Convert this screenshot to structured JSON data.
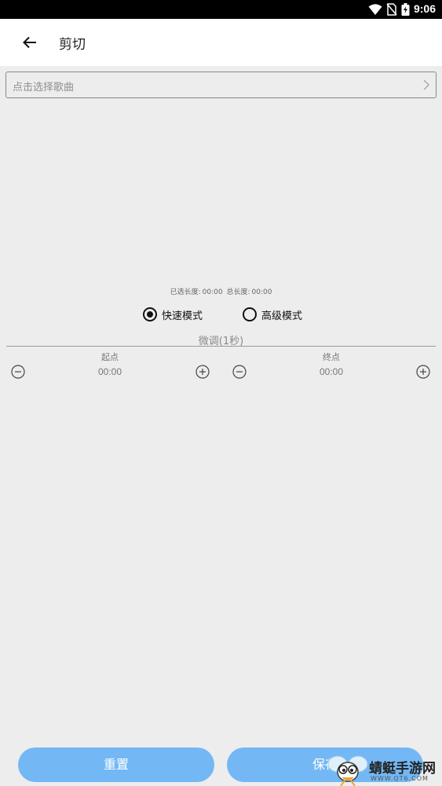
{
  "status_bar": {
    "time": "9:06"
  },
  "app_bar": {
    "title": "剪切"
  },
  "song_picker": {
    "placeholder": "点击选择歌曲"
  },
  "length_info": {
    "selected_label": "已选长度:",
    "selected_value": "00:00",
    "total_label": "总长度:",
    "total_value": "00:00"
  },
  "modes": [
    {
      "label": "快速模式",
      "checked": true
    },
    {
      "label": "高级模式",
      "checked": false
    }
  ],
  "fine_tune": {
    "label": "微调(1秒)"
  },
  "start_point": {
    "label": "起点",
    "value": "00:00"
  },
  "end_point": {
    "label": "终点",
    "value": "00:00"
  },
  "actions": {
    "reset_label": "重置",
    "save_label": "保存"
  },
  "watermark": {
    "text": "蜻蜓手游网",
    "url": "WWW.QT6.COM"
  },
  "colors": {
    "accent": "#73b8f5",
    "background": "#ededed",
    "app_bar": "#ffffff"
  }
}
